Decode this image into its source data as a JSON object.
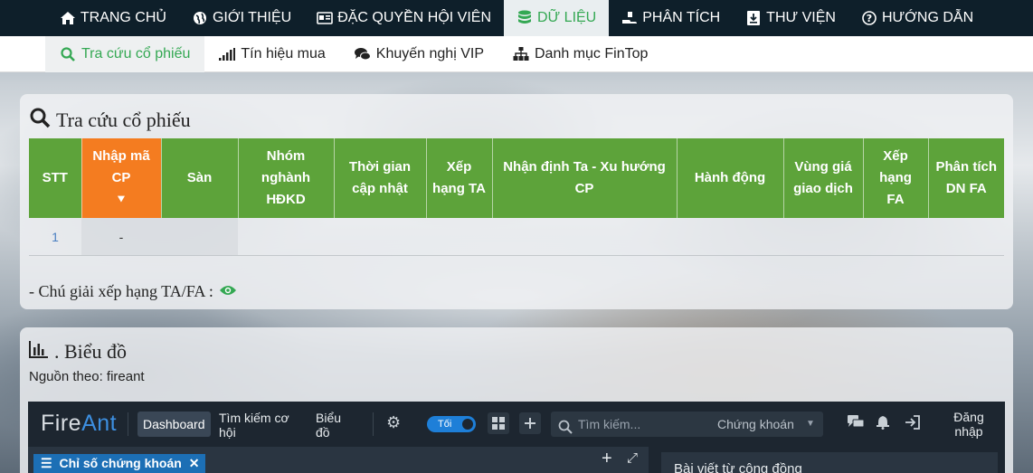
{
  "topnav": {
    "items": [
      {
        "label": "TRANG CHỦ",
        "icon": "home-icon"
      },
      {
        "label": "GIỚI THIỆU",
        "icon": "globe-icon"
      },
      {
        "label": "ĐẶC QUYỀN HỘI VIÊN",
        "icon": "id-card-icon"
      },
      {
        "label": "DỮ LIỆU",
        "icon": "database-icon"
      },
      {
        "label": "PHÂN TÍCH",
        "icon": "hand-coins-icon"
      },
      {
        "label": "THƯ VIỆN",
        "icon": "download-icon"
      },
      {
        "label": "HƯỚNG DẪN",
        "icon": "question-circle-icon"
      }
    ],
    "active": "DỮ LIỆU"
  },
  "subnav": {
    "items": [
      {
        "label": "Tra cứu cổ phiếu",
        "icon": "search-icon"
      },
      {
        "label": "Tín hiệu mua",
        "icon": "signal-icon"
      },
      {
        "label": "Khuyến nghị VIP",
        "icon": "comments-icon"
      },
      {
        "label": "Danh mục FinTop",
        "icon": "sitemap-icon"
      }
    ],
    "active": "Tra cứu cổ phiếu"
  },
  "lookup": {
    "title": "Tra cứu cổ phiếu",
    "columns": [
      "STT",
      "Nhập mã CP",
      "Sàn",
      "Nhóm nghành HĐKD",
      "Thời gian cập nhật",
      "Xếp hạng TA",
      "Nhận định Ta - Xu hướng CP",
      "Hành động",
      "Vùng giá giao dịch",
      "Xếp hạng FA",
      "Phân tích DN FA"
    ],
    "rows": [
      {
        "stt": "1",
        "code": "-"
      }
    ],
    "legend": "- Chú giải xếp hạng TA/FA :"
  },
  "chart": {
    "title": ". Biểu đồ",
    "source": "Nguồn theo: fireant"
  },
  "fireant": {
    "logo_a": "Fire",
    "logo_b": "Ant",
    "dashboard": "Dashboard",
    "link_search": "Tìm kiếm cơ hội",
    "link_chart": "Biểu đồ",
    "toggle": "Tối",
    "search_placeholder": "Tìm kiếm...",
    "search_scope": "Chứng khoán",
    "login": "Đăng nhập",
    "left_tab": "Chỉ số chứng khoán",
    "right_title": "Bài viết từ cộng đồng"
  },
  "colors": {
    "accent_green": "#34a853",
    "table_header": "#5da33a",
    "highlight_orange": "#f47c20",
    "nav_dark": "#0e1f2a"
  }
}
